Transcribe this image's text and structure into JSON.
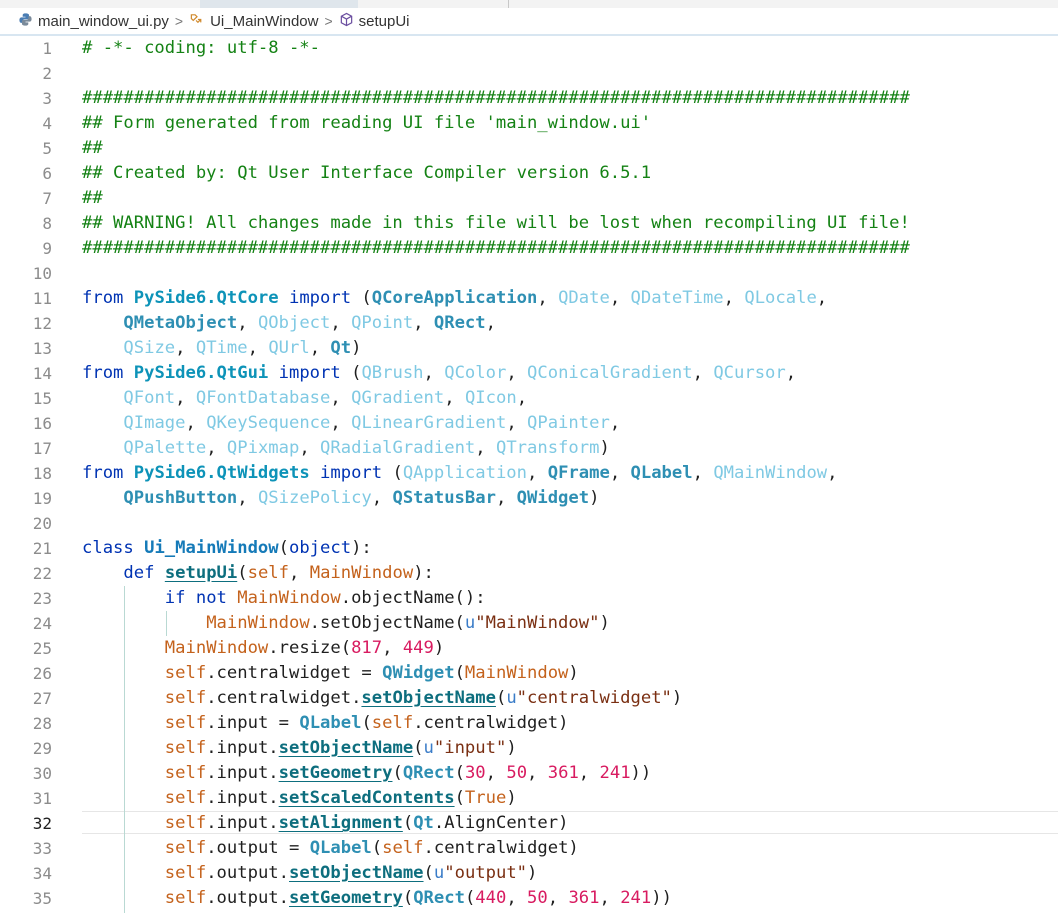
{
  "breadcrumb": {
    "file": "main_window_ui.py",
    "class": "Ui_MainWindow",
    "method": "setupUi"
  },
  "editor": {
    "current_line": 32,
    "lines": [
      {
        "n": "1",
        "segs": [
          [
            "c",
            "# -*- coding: utf-8 -*-"
          ]
        ]
      },
      {
        "n": "2",
        "segs": []
      },
      {
        "n": "3",
        "segs": [
          [
            "c",
            "################################################################################"
          ]
        ]
      },
      {
        "n": "4",
        "segs": [
          [
            "c",
            "## Form generated from reading UI file 'main_window.ui'"
          ]
        ]
      },
      {
        "n": "5",
        "segs": [
          [
            "c",
            "##"
          ]
        ]
      },
      {
        "n": "6",
        "segs": [
          [
            "c",
            "## Created by: Qt User Interface Compiler version 6.5.1"
          ]
        ]
      },
      {
        "n": "7",
        "segs": [
          [
            "c",
            "##"
          ]
        ]
      },
      {
        "n": "8",
        "segs": [
          [
            "c",
            "## WARNING! All changes made in this file will be lost when recompiling UI file!"
          ]
        ]
      },
      {
        "n": "9",
        "segs": [
          [
            "c",
            "################################################################################"
          ]
        ]
      },
      {
        "n": "10",
        "segs": []
      },
      {
        "n": "11",
        "segs": [
          [
            "kw",
            "from "
          ],
          [
            "m",
            "PySide6.QtCore"
          ],
          [
            "kw",
            " import "
          ],
          [
            "",
            "("
          ],
          [
            "ik",
            "QCoreApplication"
          ],
          [
            "",
            ", "
          ],
          [
            "iu",
            "QDate"
          ],
          [
            "",
            ", "
          ],
          [
            "iu",
            "QDateTime"
          ],
          [
            "",
            ", "
          ],
          [
            "iu",
            "QLocale"
          ],
          [
            "",
            ","
          ]
        ]
      },
      {
        "n": "12",
        "segs": [
          [
            "",
            "    "
          ],
          [
            "ik",
            "QMetaObject"
          ],
          [
            "",
            ", "
          ],
          [
            "iu",
            "QObject"
          ],
          [
            "",
            ", "
          ],
          [
            "iu",
            "QPoint"
          ],
          [
            "",
            ", "
          ],
          [
            "ik",
            "QRect"
          ],
          [
            "",
            ","
          ]
        ]
      },
      {
        "n": "13",
        "segs": [
          [
            "",
            "    "
          ],
          [
            "iu",
            "QSize"
          ],
          [
            "",
            ", "
          ],
          [
            "iu",
            "QTime"
          ],
          [
            "",
            ", "
          ],
          [
            "iu",
            "QUrl"
          ],
          [
            "",
            ", "
          ],
          [
            "ik",
            "Qt"
          ],
          [
            "",
            ")"
          ]
        ]
      },
      {
        "n": "14",
        "segs": [
          [
            "kw",
            "from "
          ],
          [
            "m",
            "PySide6.QtGui"
          ],
          [
            "kw",
            " import "
          ],
          [
            "",
            "("
          ],
          [
            "iu",
            "QBrush"
          ],
          [
            "",
            ", "
          ],
          [
            "iu",
            "QColor"
          ],
          [
            "",
            ", "
          ],
          [
            "iu",
            "QConicalGradient"
          ],
          [
            "",
            ", "
          ],
          [
            "iu",
            "QCursor"
          ],
          [
            "",
            ","
          ]
        ]
      },
      {
        "n": "15",
        "segs": [
          [
            "",
            "    "
          ],
          [
            "iu",
            "QFont"
          ],
          [
            "",
            ", "
          ],
          [
            "iu",
            "QFontDatabase"
          ],
          [
            "",
            ", "
          ],
          [
            "iu",
            "QGradient"
          ],
          [
            "",
            ", "
          ],
          [
            "iu",
            "QIcon"
          ],
          [
            "",
            ","
          ]
        ]
      },
      {
        "n": "16",
        "segs": [
          [
            "",
            "    "
          ],
          [
            "iu",
            "QImage"
          ],
          [
            "",
            ", "
          ],
          [
            "iu",
            "QKeySequence"
          ],
          [
            "",
            ", "
          ],
          [
            "iu",
            "QLinearGradient"
          ],
          [
            "",
            ", "
          ],
          [
            "iu",
            "QPainter"
          ],
          [
            "",
            ","
          ]
        ]
      },
      {
        "n": "17",
        "segs": [
          [
            "",
            "    "
          ],
          [
            "iu",
            "QPalette"
          ],
          [
            "",
            ", "
          ],
          [
            "iu",
            "QPixmap"
          ],
          [
            "",
            ", "
          ],
          [
            "iu",
            "QRadialGradient"
          ],
          [
            "",
            ", "
          ],
          [
            "iu",
            "QTransform"
          ],
          [
            "",
            ")"
          ]
        ]
      },
      {
        "n": "18",
        "segs": [
          [
            "kw",
            "from "
          ],
          [
            "m",
            "PySide6.QtWidgets"
          ],
          [
            "kw",
            " import "
          ],
          [
            "",
            "("
          ],
          [
            "iu",
            "QApplication"
          ],
          [
            "",
            ", "
          ],
          [
            "ik",
            "QFrame"
          ],
          [
            "",
            ", "
          ],
          [
            "ik",
            "QLabel"
          ],
          [
            "",
            ", "
          ],
          [
            "iu",
            "QMainWindow"
          ],
          [
            "",
            ","
          ]
        ]
      },
      {
        "n": "19",
        "segs": [
          [
            "",
            "    "
          ],
          [
            "ik",
            "QPushButton"
          ],
          [
            "",
            ", "
          ],
          [
            "iu",
            "QSizePolicy"
          ],
          [
            "",
            ", "
          ],
          [
            "ik",
            "QStatusBar"
          ],
          [
            "",
            ", "
          ],
          [
            "ik",
            "QWidget"
          ],
          [
            "",
            ")"
          ]
        ]
      },
      {
        "n": "20",
        "segs": []
      },
      {
        "n": "21",
        "segs": [
          [
            "kw",
            "class "
          ],
          [
            "cl",
            "Ui_MainWindow"
          ],
          [
            "",
            "("
          ],
          [
            "kw",
            "object"
          ],
          [
            "",
            "):"
          ]
        ]
      },
      {
        "n": "22",
        "segs": [
          [
            "",
            "    "
          ],
          [
            "kw",
            "def "
          ],
          [
            "fn",
            "setupUi"
          ],
          [
            "",
            "("
          ],
          [
            "sf",
            "self"
          ],
          [
            "",
            ", "
          ],
          [
            "pm",
            "MainWindow"
          ],
          [
            "",
            "):"
          ]
        ]
      },
      {
        "n": "23",
        "segs": [
          [
            "",
            "        "
          ],
          [
            "kw",
            "if not "
          ],
          [
            "pm",
            "MainWindow"
          ],
          [
            "",
            ".objectName():"
          ]
        ]
      },
      {
        "n": "24",
        "segs": [
          [
            "",
            "            "
          ],
          [
            "pm",
            "MainWindow"
          ],
          [
            "",
            ".setObjectName("
          ],
          [
            "pre",
            "u"
          ],
          [
            "st",
            "\"MainWindow\""
          ],
          [
            "",
            ")"
          ]
        ]
      },
      {
        "n": "25",
        "segs": [
          [
            "",
            "        "
          ],
          [
            "pm",
            "MainWindow"
          ],
          [
            "",
            ".resize("
          ],
          [
            "nm",
            "817"
          ],
          [
            "",
            ", "
          ],
          [
            "nm",
            "449"
          ],
          [
            "",
            ")"
          ]
        ]
      },
      {
        "n": "26",
        "segs": [
          [
            "",
            "        "
          ],
          [
            "sf",
            "self"
          ],
          [
            "",
            ".centralwidget = "
          ],
          [
            "ik",
            "QWidget"
          ],
          [
            "",
            "("
          ],
          [
            "pm",
            "MainWindow"
          ],
          [
            "",
            ")"
          ]
        ]
      },
      {
        "n": "27",
        "segs": [
          [
            "",
            "        "
          ],
          [
            "sf",
            "self"
          ],
          [
            "",
            ".centralwidget."
          ],
          [
            "fn",
            "setObjectName"
          ],
          [
            "",
            "("
          ],
          [
            "pre",
            "u"
          ],
          [
            "st",
            "\"centralwidget\""
          ],
          [
            "",
            ")"
          ]
        ]
      },
      {
        "n": "28",
        "segs": [
          [
            "",
            "        "
          ],
          [
            "sf",
            "self"
          ],
          [
            "",
            ".input = "
          ],
          [
            "ik",
            "QLabel"
          ],
          [
            "",
            "("
          ],
          [
            "sf",
            "self"
          ],
          [
            "",
            ".centralwidget)"
          ]
        ]
      },
      {
        "n": "29",
        "segs": [
          [
            "",
            "        "
          ],
          [
            "sf",
            "self"
          ],
          [
            "",
            ".input."
          ],
          [
            "fn",
            "setObjectName"
          ],
          [
            "",
            "("
          ],
          [
            "pre",
            "u"
          ],
          [
            "st",
            "\"input\""
          ],
          [
            "",
            ")"
          ]
        ]
      },
      {
        "n": "30",
        "segs": [
          [
            "",
            "        "
          ],
          [
            "sf",
            "self"
          ],
          [
            "",
            ".input."
          ],
          [
            "fn",
            "setGeometry"
          ],
          [
            "",
            "("
          ],
          [
            "ik",
            "QRect"
          ],
          [
            "",
            "("
          ],
          [
            "nm",
            "30"
          ],
          [
            "",
            ", "
          ],
          [
            "nm",
            "50"
          ],
          [
            "",
            ", "
          ],
          [
            "nm",
            "361"
          ],
          [
            "",
            ", "
          ],
          [
            "nm",
            "241"
          ],
          [
            "",
            "))"
          ]
        ]
      },
      {
        "n": "31",
        "segs": [
          [
            "",
            "        "
          ],
          [
            "sf",
            "self"
          ],
          [
            "",
            ".input."
          ],
          [
            "fn",
            "setScaledContents"
          ],
          [
            "",
            "("
          ],
          [
            "sf",
            "True"
          ],
          [
            "",
            ")"
          ]
        ]
      },
      {
        "n": "32",
        "segs": [
          [
            "",
            "        "
          ],
          [
            "sf",
            "self"
          ],
          [
            "",
            ".input."
          ],
          [
            "fn",
            "setAlignment"
          ],
          [
            "",
            "("
          ],
          [
            "ik",
            "Qt"
          ],
          [
            "",
            ".AlignCenter)"
          ]
        ]
      },
      {
        "n": "33",
        "segs": [
          [
            "",
            "        "
          ],
          [
            "sf",
            "self"
          ],
          [
            "",
            ".output = "
          ],
          [
            "ik",
            "QLabel"
          ],
          [
            "",
            "("
          ],
          [
            "sf",
            "self"
          ],
          [
            "",
            ".centralwidget)"
          ]
        ]
      },
      {
        "n": "34",
        "segs": [
          [
            "",
            "        "
          ],
          [
            "sf",
            "self"
          ],
          [
            "",
            ".output."
          ],
          [
            "fn",
            "setObjectName"
          ],
          [
            "",
            "("
          ],
          [
            "pre",
            "u"
          ],
          [
            "st",
            "\"output\""
          ],
          [
            "",
            ")"
          ]
        ]
      },
      {
        "n": "35",
        "segs": [
          [
            "",
            "        "
          ],
          [
            "sf",
            "self"
          ],
          [
            "",
            ".output."
          ],
          [
            "fn",
            "setGeometry"
          ],
          [
            "",
            "("
          ],
          [
            "ik",
            "QRect"
          ],
          [
            "",
            "("
          ],
          [
            "nm",
            "440"
          ],
          [
            "",
            ", "
          ],
          [
            "nm",
            "50"
          ],
          [
            "",
            ", "
          ],
          [
            "nm",
            "361"
          ],
          [
            "",
            ", "
          ],
          [
            "nm",
            "241"
          ],
          [
            "",
            "))"
          ]
        ]
      }
    ]
  },
  "icons": {
    "file": "python-icon",
    "class": "class-icon",
    "method": "method-cube-icon"
  },
  "colors": {
    "comment": "#148214",
    "keyword": "#0033b3",
    "number": "#d81b60",
    "string": "#7a2f12",
    "self": "#c4621c"
  }
}
